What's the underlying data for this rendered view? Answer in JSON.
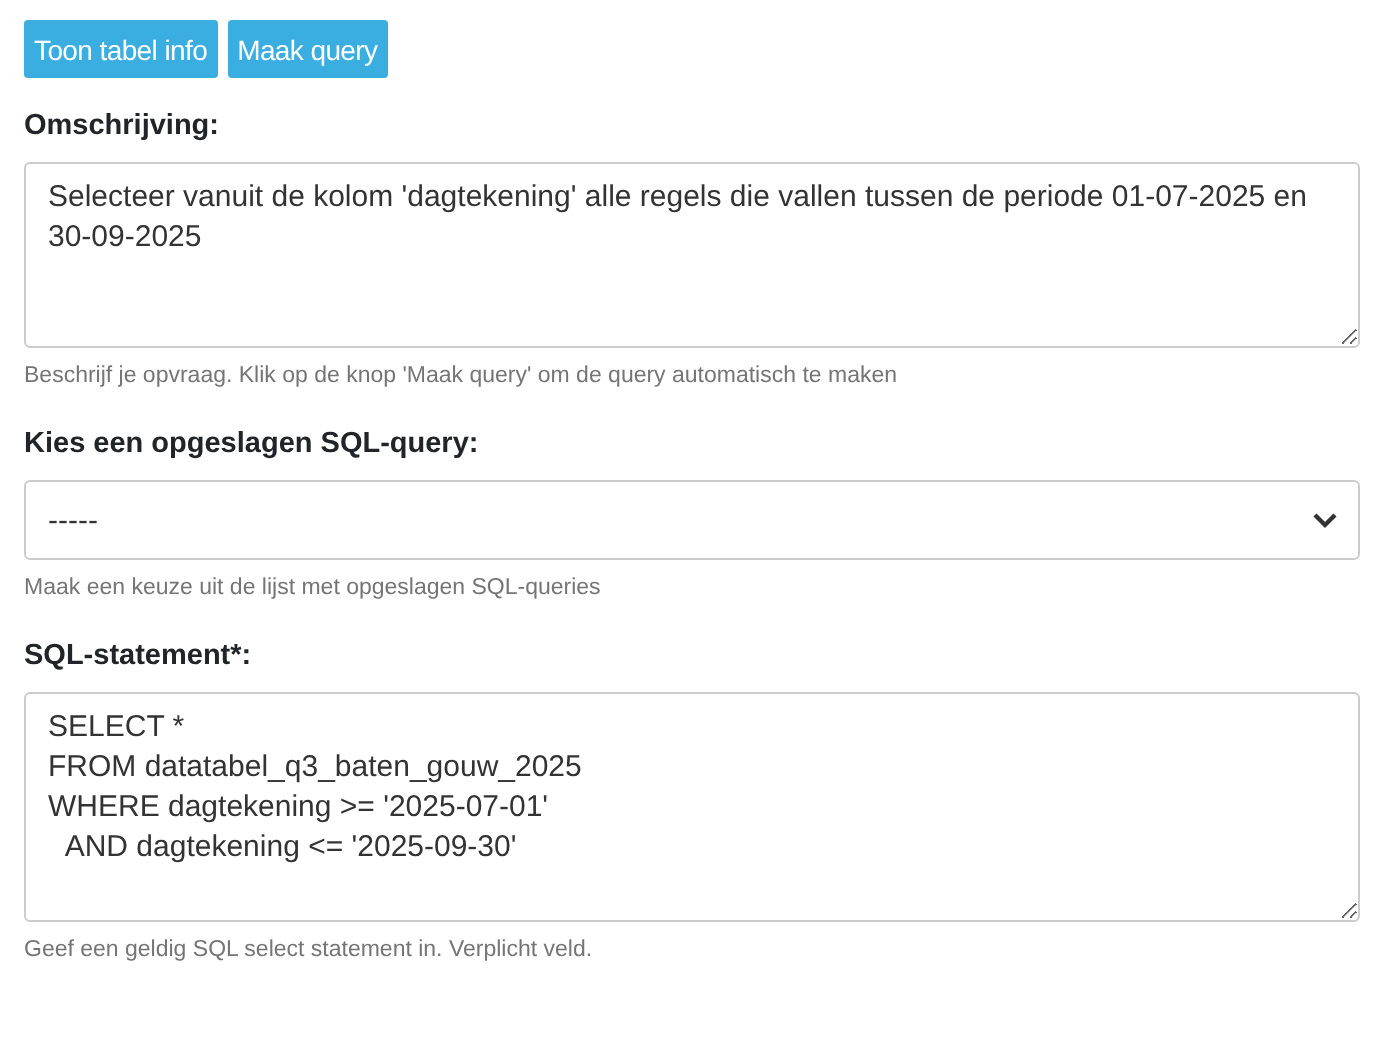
{
  "buttons": [
    {
      "label": "Toon tabel info"
    },
    {
      "label": "Maak query"
    }
  ],
  "fields": [
    {
      "kind": "textarea",
      "label": "Omschrijving:",
      "value": "Selecteer vanuit de kolom 'dagtekening' alle regels die vallen tussen de periode 01-07-2025 en 30-09-2025",
      "help": "Beschrijf je opvraag. Klik op de knop 'Maak query' om de query automatisch te maken"
    },
    {
      "kind": "select",
      "label": "Kies een opgeslagen SQL-query:",
      "value": "-----",
      "help": "Maak een keuze uit de lijst met opgeslagen SQL-queries"
    },
    {
      "kind": "code",
      "label": "SQL-statement*:",
      "value": "SELECT *\nFROM datatabel_q3_baten_gouw_2025\nWHERE dagtekening >= '2025-07-01'\n  AND dagtekening <= '2025-09-30'",
      "help": "Geef een geldig SQL select statement in. Verplicht veld."
    }
  ]
}
